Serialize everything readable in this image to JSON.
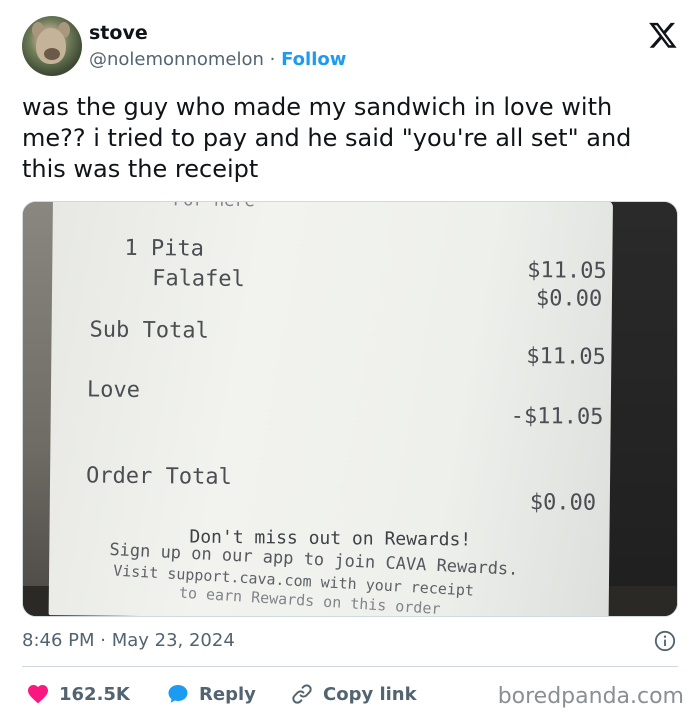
{
  "author": {
    "name": "stove",
    "handle": "@nolemonnomelon",
    "separator": "·",
    "follow_label": "Follow"
  },
  "tweet": {
    "text": "was the guy who made my sandwich in love with me?? i tried to pay and he said \"you're all set\" and this was the receipt"
  },
  "receipt": {
    "top_partial": "For here",
    "item_qty_name": "1 Pita",
    "item_sub": "Falafel",
    "item_price": "$11.05",
    "item_sub_price": "$0.00",
    "subtotal_label": "Sub Total",
    "subtotal_value": "$11.05",
    "love_label": "Love",
    "love_value": "-$11.05",
    "order_total_label": "Order Total",
    "order_total_value": "$0.00",
    "rewards_line": "Don't miss out on Rewards!",
    "signup_line": "Sign up on our app to join CAVA Rewards.",
    "visit_line": "Visit support.cava.com with your receipt",
    "earn_line": "to earn Rewards on this order"
  },
  "meta": {
    "time": "8:46 PM",
    "separator": "·",
    "date": "May 23, 2024",
    "timestamp_text": "8:46 PM · May 23, 2024"
  },
  "actions": {
    "likes": "162.5K",
    "reply_label": "Reply",
    "copy_label": "Copy link"
  },
  "watermark": "boredpanda.com",
  "colors": {
    "accent": "#1d9bf0",
    "like": "#f91880",
    "text": "#0f1419",
    "muted": "#536471"
  },
  "icons": [
    "x-logo-icon",
    "heart-icon",
    "reply-bubble-icon",
    "link-icon",
    "info-icon"
  ]
}
